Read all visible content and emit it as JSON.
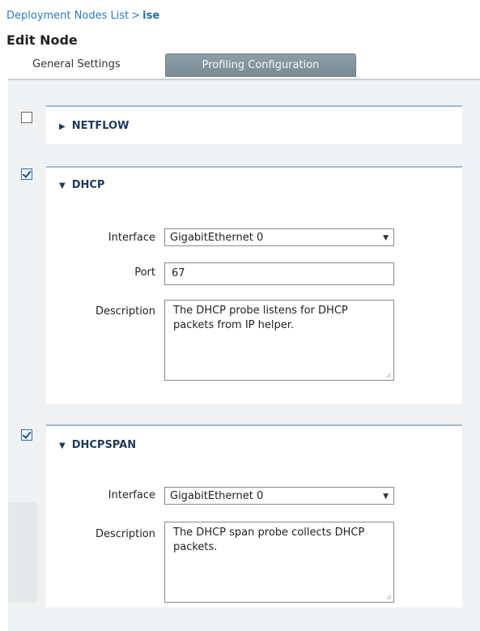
{
  "breadcrumb": {
    "link": "Deployment Nodes List",
    "separator": ">",
    "current": "ise"
  },
  "page_title": "Edit Node",
  "tabs": {
    "general": "General Settings",
    "profiling": "Profiling Configuration"
  },
  "sections": {
    "netflow": {
      "title": "NETFLOW",
      "enabled": false,
      "expanded": false
    },
    "dhcp": {
      "title": "DHCP",
      "enabled": true,
      "expanded": true,
      "interface_label": "Interface",
      "interface_value": "GigabitEthernet 0",
      "port_label": "Port",
      "port_value": "67",
      "description_label": "Description",
      "description_value": "The DHCP probe listens for DHCP packets from IP helper."
    },
    "dhcpspan": {
      "title": "DHCPSPAN",
      "enabled": true,
      "expanded": true,
      "interface_label": "Interface",
      "interface_value": "GigabitEthernet 0",
      "description_label": "Description",
      "description_value": "The DHCP span probe collects DHCP packets."
    }
  },
  "icons": {
    "collapsed": "triangle-right-icon",
    "expanded": "triangle-down-icon",
    "dropdown": "chevron-down-icon"
  }
}
